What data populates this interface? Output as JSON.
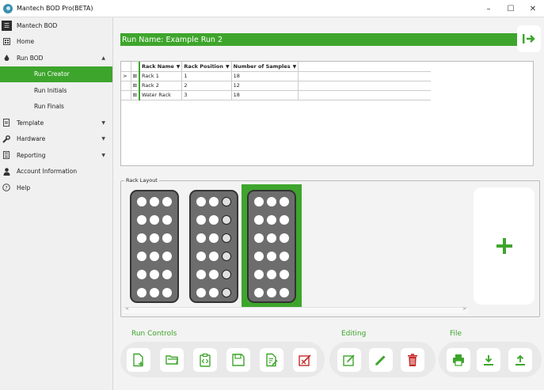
{
  "window": {
    "title": "Mantech BOD Pro(BETA)",
    "minimize": "–",
    "maximize": "☐",
    "close": "✕"
  },
  "sidebar": {
    "items": [
      {
        "label": "Mantech BOD",
        "icon": "menu-icon"
      },
      {
        "label": "Home",
        "icon": "home-icon"
      },
      {
        "label": "Run BOD",
        "icon": "drop-icon",
        "arrow": "▲"
      },
      {
        "label": "Run Creator",
        "sub": true,
        "active": true
      },
      {
        "label": "Run Initials",
        "sub": true
      },
      {
        "label": "Run Finals",
        "sub": true
      },
      {
        "label": "Template",
        "icon": "document-icon",
        "arrow": "▼"
      },
      {
        "label": "Hardware",
        "icon": "wrench-icon",
        "arrow": "▼"
      },
      {
        "label": "Reporting",
        "icon": "report-icon",
        "arrow": "▼"
      },
      {
        "label": "Account Information",
        "icon": "person-icon"
      },
      {
        "label": "Help",
        "icon": "help-icon"
      }
    ]
  },
  "run": {
    "name_label": "Run Name: Example Run 2"
  },
  "grid": {
    "columns": [
      "Rack Name",
      "Rack Position",
      "Number of Samples"
    ],
    "rows": [
      {
        "expander": ">",
        "plus": "⊞",
        "name": "Rack 1",
        "position": "1",
        "samples": "18"
      },
      {
        "expander": "",
        "plus": "⊞",
        "name": "Rack 2",
        "position": "2",
        "samples": "12"
      },
      {
        "expander": "",
        "plus": "⊞",
        "name": "Water Rack",
        "position": "3",
        "samples": "18"
      }
    ]
  },
  "rack_layout": {
    "legend": "Rack Layout",
    "scroll_left": "<",
    "scroll_right": ">"
  },
  "toolbar": {
    "run_controls_label": "Run Controls",
    "editing_label": "Editing",
    "file_label": "File"
  },
  "colors": {
    "accent": "#3ea52c",
    "delete": "#c62828",
    "rack": "#6d6d6d"
  }
}
